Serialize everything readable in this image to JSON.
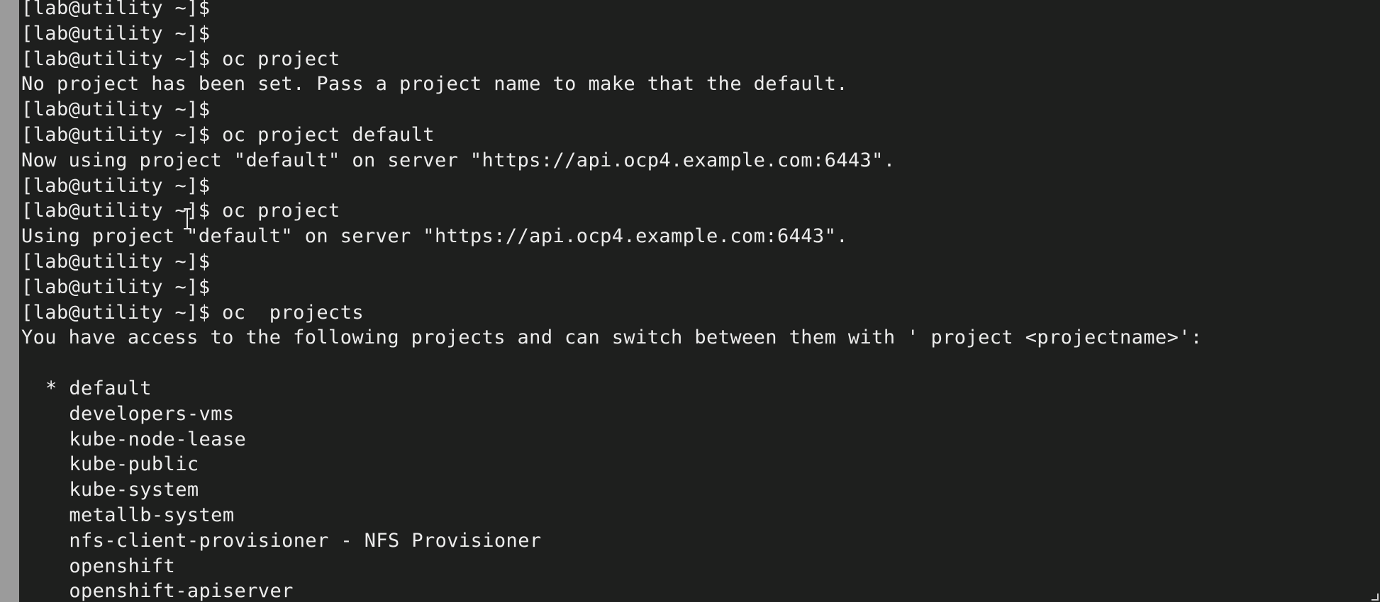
{
  "terminal": {
    "lines": [
      "[lab@utility ~]$",
      "[lab@utility ~]$",
      "[lab@utility ~]$ oc project",
      "No project has been set. Pass a project name to make that the default.",
      "[lab@utility ~]$",
      "[lab@utility ~]$ oc project default",
      "Now using project \"default\" on server \"https://api.ocp4.example.com:6443\".",
      "[lab@utility ~]$",
      "[lab@utility ~]$ oc project",
      "Using project \"default\" on server \"https://api.ocp4.example.com:6443\".",
      "[lab@utility ~]$",
      "[lab@utility ~]$",
      "[lab@utility ~]$ oc  projects",
      "You have access to the following projects and can switch between them with ' project <projectname>':",
      ""
    ],
    "projects": [
      {
        "marker": "* ",
        "name": "default"
      },
      {
        "marker": "  ",
        "name": "developers-vms"
      },
      {
        "marker": "  ",
        "name": "kube-node-lease"
      },
      {
        "marker": "  ",
        "name": "kube-public"
      },
      {
        "marker": "  ",
        "name": "kube-system"
      },
      {
        "marker": "  ",
        "name": "metallb-system"
      },
      {
        "marker": "  ",
        "name": "nfs-client-provisioner - NFS Provisioner"
      },
      {
        "marker": "  ",
        "name": "openshift"
      },
      {
        "marker": "  ",
        "name": "openshift-apiserver"
      }
    ]
  },
  "colors": {
    "background": "#1e1f1e",
    "foreground": "#ececec",
    "left_strip": "#9b9b9b"
  },
  "icons": {
    "mouse_cursor": "text-ibeam-cursor-icon",
    "resize": "resize-grip-icon"
  }
}
